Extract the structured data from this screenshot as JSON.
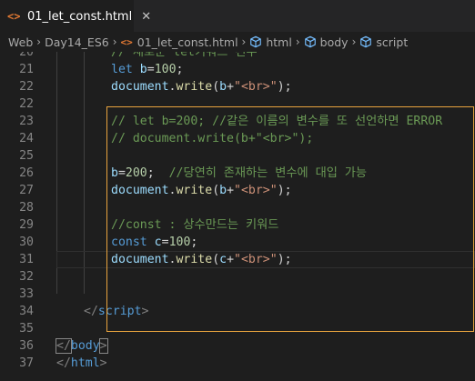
{
  "tab": {
    "icon_glyph": "<>",
    "label": "01_let_const.html",
    "close_glyph": "✕"
  },
  "breadcrumbs": [
    {
      "label": "Web",
      "icon": null
    },
    {
      "label": "Day14_ES6",
      "icon": null
    },
    {
      "label": "01_let_const.html",
      "icon": "html-icon"
    },
    {
      "label": "html",
      "icon": "cube-icon"
    },
    {
      "label": "body",
      "icon": "cube-icon"
    },
    {
      "label": "script",
      "icon": "cube-icon"
    }
  ],
  "colors": {
    "highlight_border": "#e8a33e",
    "html_icon": "#e37933",
    "cube_icon": "#75beff"
  },
  "lines": [
    {
      "num": "20",
      "tokens": [
        [
          "cm",
          "// 새로운 let키워드 선두"
        ]
      ]
    },
    {
      "num": "21",
      "tokens": [
        [
          "kw",
          "let"
        ],
        [
          "pl",
          " "
        ],
        [
          "id",
          "b"
        ],
        [
          "pl",
          "="
        ],
        [
          "num",
          "100"
        ],
        [
          "pl",
          ";"
        ]
      ]
    },
    {
      "num": "22",
      "tokens": [
        [
          "id",
          "document"
        ],
        [
          "pl",
          "."
        ],
        [
          "fn",
          "write"
        ],
        [
          "pl",
          "("
        ],
        [
          "id",
          "b"
        ],
        [
          "pl",
          "+"
        ],
        [
          "str",
          "\"<br>\""
        ],
        [
          "pl",
          ");"
        ]
      ]
    },
    {
      "num": "22",
      "tokens": []
    },
    {
      "num": "23",
      "tokens": [
        [
          "cm",
          "// let b=200; //같은 이름의 변수를 또 선언하면 ERROR"
        ]
      ]
    },
    {
      "num": "24",
      "tokens": [
        [
          "cm",
          "// document.write(b+\"<br>\");"
        ]
      ]
    },
    {
      "num": "25",
      "tokens": []
    },
    {
      "num": "26",
      "tokens": [
        [
          "id",
          "b"
        ],
        [
          "pl",
          "="
        ],
        [
          "num",
          "200"
        ],
        [
          "pl",
          ";  "
        ],
        [
          "cm",
          "//당연히 존재하는 변수에 대입 가능"
        ]
      ]
    },
    {
      "num": "27",
      "tokens": [
        [
          "id",
          "document"
        ],
        [
          "pl",
          "."
        ],
        [
          "fn",
          "write"
        ],
        [
          "pl",
          "("
        ],
        [
          "id",
          "b"
        ],
        [
          "pl",
          "+"
        ],
        [
          "str",
          "\"<br>\""
        ],
        [
          "pl",
          ");"
        ]
      ]
    },
    {
      "num": "28",
      "tokens": []
    },
    {
      "num": "29",
      "tokens": [
        [
          "cm",
          "//const : 상수만드는 키워드"
        ]
      ]
    },
    {
      "num": "30",
      "tokens": [
        [
          "kw",
          "const"
        ],
        [
          "pl",
          " "
        ],
        [
          "id",
          "c"
        ],
        [
          "pl",
          "="
        ],
        [
          "num",
          "100"
        ],
        [
          "pl",
          ";"
        ]
      ]
    },
    {
      "num": "31",
      "tokens": [
        [
          "id",
          "document"
        ],
        [
          "pl",
          "."
        ],
        [
          "fn",
          "write"
        ],
        [
          "pl",
          "("
        ],
        [
          "id",
          "c"
        ],
        [
          "pl",
          "+"
        ],
        [
          "str",
          "\"<br>\""
        ],
        [
          "pl",
          ");"
        ]
      ]
    },
    {
      "num": "32",
      "tokens": []
    },
    {
      "num": "33",
      "tokens": []
    },
    {
      "num": "34",
      "tokens": [
        [
          "tagc",
          "</"
        ],
        [
          "tagn",
          "script"
        ],
        [
          "tagc",
          ">"
        ]
      ]
    },
    {
      "num": "35",
      "tokens": []
    },
    {
      "num": "36",
      "tokens": [
        [
          "tagc",
          "</"
        ],
        [
          "tagn",
          "body"
        ],
        [
          "tagc",
          ">"
        ]
      ]
    },
    {
      "num": "37",
      "tokens": [
        [
          "tagc",
          "</"
        ],
        [
          "tagn",
          "html"
        ],
        [
          "tagc",
          ">"
        ]
      ]
    }
  ]
}
